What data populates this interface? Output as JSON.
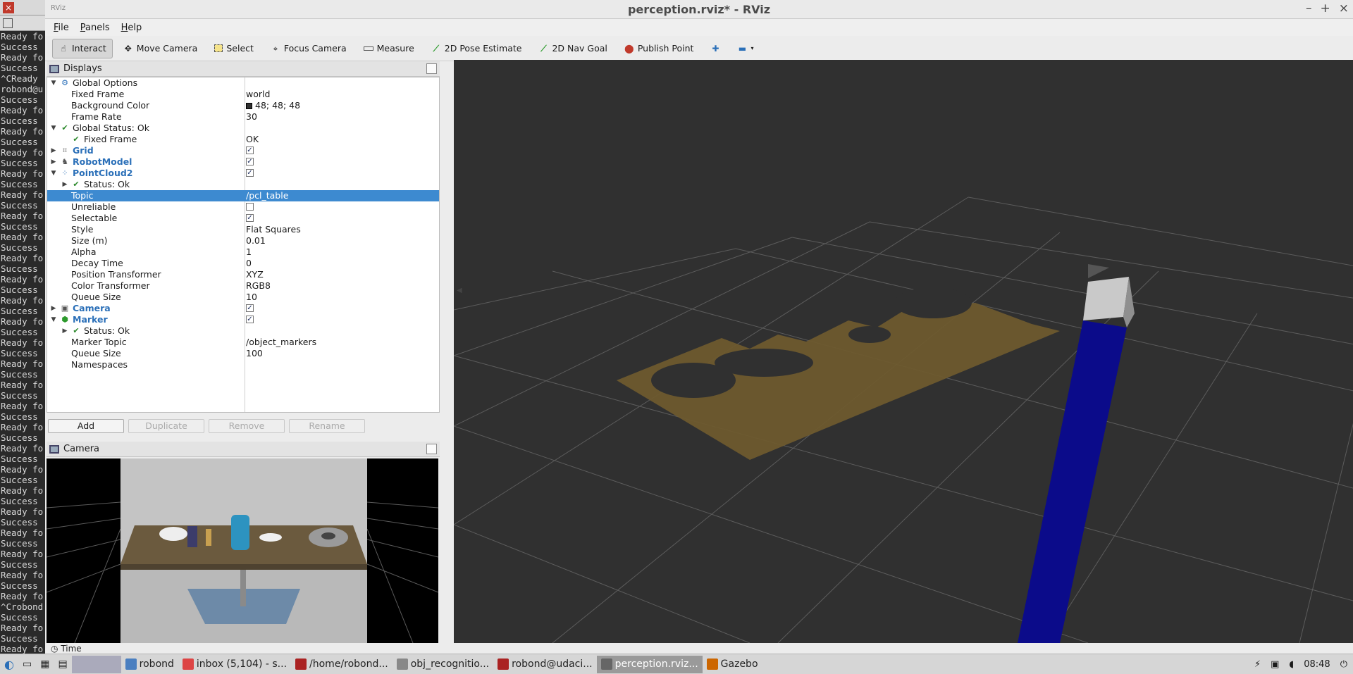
{
  "terminal": {
    "lines": [
      "Ready fo",
      "Success",
      "Ready fo",
      "Success",
      "^CReady",
      "robond@u",
      "Success",
      "Ready fo",
      "Success",
      "Ready fo",
      "Success",
      "Ready fo",
      "Success",
      "Ready fo",
      "Success",
      "Ready fo",
      "Success",
      "Ready fo",
      "Success",
      "Ready fo",
      "Success",
      "Ready fo",
      "Success",
      "Ready fo",
      "Success",
      "Ready fo",
      "Success",
      "Ready fo",
      "Success",
      "Ready fo",
      "Success",
      "Ready fo",
      "Success",
      "Ready fo",
      "Success",
      "Ready fo",
      "Success",
      "Ready fo",
      "Success",
      "Ready fo",
      "Success",
      "Ready fo",
      "Success",
      "Ready fo",
      "Success",
      "Ready fo",
      "Success",
      "Ready fo",
      "Success",
      "Ready fo",
      "Success",
      "Ready fo",
      "Success",
      "Ready fo",
      "^Crobond",
      "Success",
      "Ready fo",
      "Success",
      "Ready fo",
      "Success"
    ]
  },
  "window": {
    "title": "perception.rviz* - RViz"
  },
  "menu": [
    {
      "pre": "",
      "u": "F",
      "post": "ile"
    },
    {
      "pre": "",
      "u": "P",
      "post": "anels"
    },
    {
      "pre": "",
      "u": "H",
      "post": "elp"
    }
  ],
  "toolbar": {
    "interact": "Interact",
    "move_camera": "Move Camera",
    "select": "Select",
    "focus_camera": "Focus Camera",
    "measure": "Measure",
    "pose_estimate": "2D Pose Estimate",
    "nav_goal": "2D Nav Goal",
    "publish_point": "Publish Point"
  },
  "displays": {
    "title": "Displays",
    "rows": [
      {
        "indent": 0,
        "arrow": "▼",
        "icon": "gear",
        "name": "Global Options",
        "blue": false,
        "value": ""
      },
      {
        "indent": 1,
        "arrow": "",
        "icon": "",
        "name": "Fixed Frame",
        "blue": false,
        "value": "world"
      },
      {
        "indent": 1,
        "arrow": "",
        "icon": "",
        "name": "Background Color",
        "blue": false,
        "value": "48; 48; 48",
        "swatch": true
      },
      {
        "indent": 1,
        "arrow": "",
        "icon": "",
        "name": "Frame Rate",
        "blue": false,
        "value": "30"
      },
      {
        "indent": 0,
        "arrow": "▼",
        "icon": "check",
        "name": "Global Status: Ok",
        "blue": false,
        "value": ""
      },
      {
        "indent": 1,
        "arrow": "",
        "icon": "check",
        "name": "Fixed Frame",
        "blue": false,
        "value": "OK"
      },
      {
        "indent": 0,
        "arrow": "▶",
        "icon": "grid",
        "name": "Grid",
        "blue": true,
        "checkbox": true
      },
      {
        "indent": 0,
        "arrow": "▶",
        "icon": "robot",
        "name": "RobotModel",
        "blue": true,
        "checkbox": true
      },
      {
        "indent": 0,
        "arrow": "▼",
        "icon": "cloud",
        "name": "PointCloud2",
        "blue": true,
        "checkbox": true
      },
      {
        "indent": 1,
        "arrow": "▶",
        "icon": "check",
        "name": "Status: Ok",
        "blue": false,
        "value": ""
      },
      {
        "indent": 1,
        "arrow": "",
        "icon": "",
        "name": "Topic",
        "blue": false,
        "value": "/pcl_table",
        "selected": true
      },
      {
        "indent": 1,
        "arrow": "",
        "icon": "",
        "name": "Unreliable",
        "blue": false,
        "checkbox": false
      },
      {
        "indent": 1,
        "arrow": "",
        "icon": "",
        "name": "Selectable",
        "blue": false,
        "checkbox": true
      },
      {
        "indent": 1,
        "arrow": "",
        "icon": "",
        "name": "Style",
        "blue": false,
        "value": "Flat Squares"
      },
      {
        "indent": 1,
        "arrow": "",
        "icon": "",
        "name": "Size (m)",
        "blue": false,
        "value": "0.01"
      },
      {
        "indent": 1,
        "arrow": "",
        "icon": "",
        "name": "Alpha",
        "blue": false,
        "value": "1"
      },
      {
        "indent": 1,
        "arrow": "",
        "icon": "",
        "name": "Decay Time",
        "blue": false,
        "value": "0"
      },
      {
        "indent": 1,
        "arrow": "",
        "icon": "",
        "name": "Position Transformer",
        "blue": false,
        "value": "XYZ"
      },
      {
        "indent": 1,
        "arrow": "",
        "icon": "",
        "name": "Color Transformer",
        "blue": false,
        "value": "RGB8"
      },
      {
        "indent": 1,
        "arrow": "",
        "icon": "",
        "name": "Queue Size",
        "blue": false,
        "value": "10"
      },
      {
        "indent": 0,
        "arrow": "▶",
        "icon": "camera",
        "name": "Camera",
        "blue": true,
        "checkbox": true
      },
      {
        "indent": 0,
        "arrow": "▼",
        "icon": "marker",
        "name": "Marker",
        "blue": true,
        "checkbox": true
      },
      {
        "indent": 1,
        "arrow": "▶",
        "icon": "check",
        "name": "Status: Ok",
        "blue": false,
        "value": ""
      },
      {
        "indent": 1,
        "arrow": "",
        "icon": "",
        "name": "Marker Topic",
        "blue": false,
        "value": "/object_markers"
      },
      {
        "indent": 1,
        "arrow": "",
        "icon": "",
        "name": "Queue Size",
        "blue": false,
        "value": "100"
      },
      {
        "indent": 1,
        "arrow": "",
        "icon": "",
        "name": "Namespaces",
        "blue": false,
        "value": ""
      }
    ],
    "buttons": {
      "add": "Add",
      "duplicate": "Duplicate",
      "remove": "Remove",
      "rename": "Rename"
    }
  },
  "camera_panel": {
    "title": "Camera"
  },
  "time_panel": {
    "label": "Time"
  },
  "taskbar": {
    "apps": [
      {
        "label": "robond",
        "active": false,
        "color": "#4a7fc0"
      },
      {
        "label": "inbox (5,104) - s...",
        "active": false,
        "color": "#d44"
      },
      {
        "label": "/home/robond...",
        "active": false,
        "color": "#a22"
      },
      {
        "label": "obj_recognitio...",
        "active": false,
        "color": "#888"
      },
      {
        "label": "robond@udaci...",
        "active": false,
        "color": "#a22"
      },
      {
        "label": "perception.rviz...",
        "active": true,
        "color": "#666"
      },
      {
        "label": "Gazebo",
        "active": false,
        "color": "#c60"
      }
    ],
    "clock": "08:48"
  }
}
